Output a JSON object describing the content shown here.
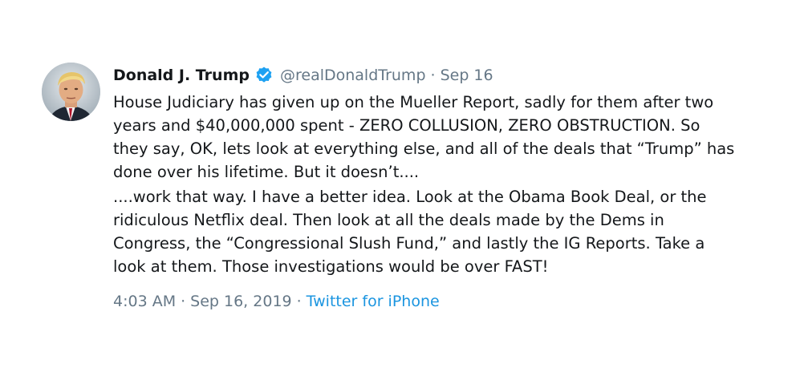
{
  "tweet": {
    "author": {
      "display_name": "Donald J. Trump",
      "handle": "@realDonaldTrump",
      "verified": true,
      "avatar_icon": "profile-photo"
    },
    "header_date": "Sep 16",
    "separator": "·",
    "paragraphs": [
      "House Judiciary has given up on the Mueller Report, sadly for them after two years and $40,000,000 spent - ZERO COLLUSION, ZERO OBSTRUCTION. So they say, OK, lets look at everything else, and all of the deals that “Trump” has done over his lifetime. But it doesn’t....",
      "....work that way. I have a better idea. Look at the Obama Book Deal, or the ridiculous Netflix deal. Then look at all the deals made by the Dems in Congress, the “Congressional Slush Fund,” and lastly the IG Reports. Take a look at them. Those investigations would be over FAST!"
    ],
    "timestamp": {
      "time": "4:03 AM",
      "date": "Sep 16, 2019",
      "source": "Twitter for iPhone"
    }
  },
  "colors": {
    "text_primary": "#14171a",
    "text_secondary": "#657786",
    "link": "#1b95e0",
    "verified_badge": "#1da1f2"
  }
}
